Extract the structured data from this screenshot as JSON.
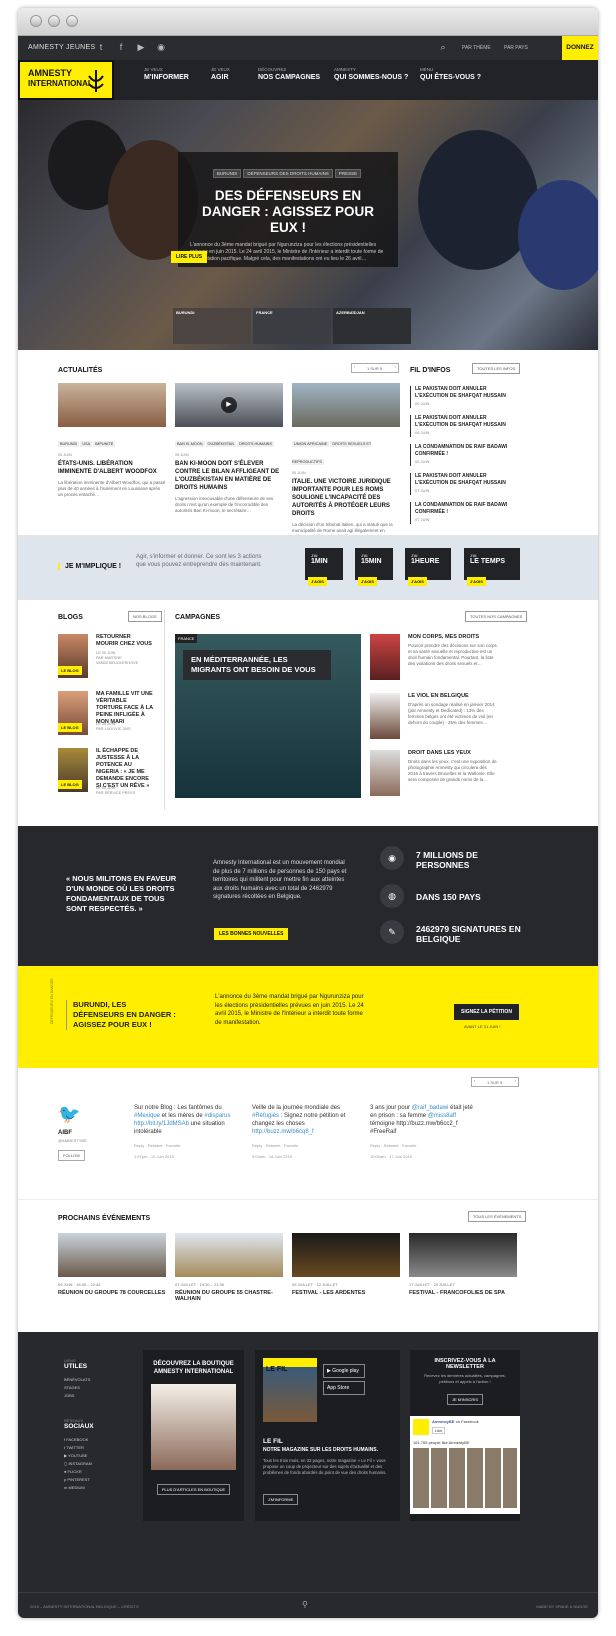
{
  "topbar": {
    "brand": "AMNESTY JEUNES",
    "theme": "PAR THÈME",
    "country": "PAR PAYS",
    "donate": "DONNEZ"
  },
  "logo": {
    "line1": "AMNESTY",
    "line2": "INTERNATIONAL"
  },
  "nav": [
    {
      "small": "JE VEUX",
      "label": "M'INFORMER"
    },
    {
      "small": "JE VEUX",
      "label": "AGIR"
    },
    {
      "small": "DÉCOUVREZ",
      "label": "NOS CAMPAGNES"
    },
    {
      "small": "AMNESTY",
      "label": "QUI SOMMES-NOUS ?"
    },
    {
      "small": "MENU",
      "label": "QUI ÊTES-VOUS ?"
    }
  ],
  "hero": {
    "tags": [
      "BURUNDI",
      "DÉFENSEURS DES DROITS HUMAINS",
      "PRESSE"
    ],
    "title": "DES DÉFENSEURS EN DANGER : AGISSEZ POUR EUX !",
    "text": "L'annonce du 3ème mandat brigué par Ngurunziza pour les élections présidentielles prévues en juin 2015. Le 24 avril 2015, le Ministre de l'Intérieur a interdit toute forme de manifestation pacifique. Malgré cela, des manifestations ont eu lieu le 26 avril…",
    "button": "LIRE PLUS",
    "thumbs": [
      "BURUNDI",
      "FRANCE",
      "AZERBAÏDJAN"
    ]
  },
  "actus": {
    "title": "ACTUALITÉS",
    "pager": "1 SUR 5",
    "cards": [
      {
        "tags": [
          "BURUNDI",
          "USA",
          "IMPUNITÉ"
        ],
        "date": "05 JUIN",
        "title": "ÉTATS-UNIS. LIBÉRATION IMMINENTE D'ALBERT WOODFOX",
        "text": "La libération imminente d'Albert Woodfox, qui a passé plus de 40 années à l'isolement en Louisiane après un procès entaché…"
      },
      {
        "tags": [
          "BAN KI-MOON",
          "OUZBÉKISTAN",
          "DROITS HUMAINS"
        ],
        "date": "05 JUIN",
        "title": "BAN KI-MOON DOIT S'ÉLEVER CONTRE LE BILAN AFFLIGEANT DE L'OUZBÉKISTAN EN MATIÈRE DE DROITS HUMAINS",
        "text": "L'agression inexcusable d'une défenseure de ses droits n'est qu'un exemple de l'incorrodible des autorités Ban Ki-moon, le secrétaire…"
      },
      {
        "tags": [
          "UNION AFRICAINE",
          "DROITS SEXUELS ET REPRODUCTIFS"
        ],
        "date": "05 JUIN",
        "title": "ITALIE. UNE VICTOIRE JURIDIQUE IMPORTANTE POUR LES ROMS SOULIGNE L'INCAPACITÉ DES AUTORITÉS À PROTÉGER LEURS DROITS",
        "text": "La décision d'un tribunal italien, qui a statué que la municipalité de Rome avait agi illégalement en reléguant de force des familles roms dans un…"
      }
    ]
  },
  "fil": {
    "title": "FIL D'INFOS",
    "button": "TOUTES LES INFOS",
    "items": [
      {
        "title": "LE PAKISTAN DOIT ANNULER L'EXÉCUTION DE SHAFQAT HUSSAIN",
        "date": "09 JUIN"
      },
      {
        "title": "LE PAKISTAN DOIT ANNULER L'EXÉCUTION DE SHAFQAT HUSSAIN",
        "date": "09 JUIN"
      },
      {
        "title": "LA CONDAMNATION DE RAIF BADAWI CONFIRMÉE !",
        "date": "09 JUIN"
      },
      {
        "title": "LE PAKISTAN DOIT ANNULER L'EXÉCUTION DE SHAFQAT HUSSAIN",
        "date": "07 JUIN"
      },
      {
        "title": "LA CONDAMNATION DE RAIF BADAWI CONFIRMÉE !",
        "date": "07 JUIN"
      }
    ]
  },
  "implique": {
    "title": "JE M'IMPLIQUE !",
    "text": "Agir, s'informer et donner. Ce sont les 3 actions que vous pouvez entreprendre dès maintenant.",
    "items": [
      {
        "s": "J'AI",
        "t": "1MIN"
      },
      {
        "s": "J'AI",
        "t": "15MIN"
      },
      {
        "s": "J'AI",
        "t": "1HEURE"
      },
      {
        "s": "J'AI",
        "t": "LE TEMPS"
      }
    ],
    "btn": "J'AGIS"
  },
  "blogs": {
    "title": "BLOGS",
    "button": "NOS BLOGS",
    "label": "LE BLOG",
    "items": [
      {
        "title": "RETOURNER MOURIR CHEZ VOUS",
        "meta1": "LE 05 JUIN",
        "meta2": "PAR MARTINE VANDENEUCKERHOVE"
      },
      {
        "title": "MA FAMILLE VIT UNE VÉRITABLE TORTURE FACE À LA PEINE INFLIGÉE À MON MARI",
        "meta1": "LE 05 JUIN",
        "meta2": "PAR LUDOVIC JAIS"
      },
      {
        "title": "IL ÉCHAPPE DE JUSTESSE À LA POTENCE AU NIGERIA : « JE ME DEMANDE ENCORE SI C'EST UN RÊVE »",
        "meta1": "LE 05 JUIN",
        "meta2": "PAR SERVICE PRESS"
      }
    ]
  },
  "campagnes": {
    "title": "CAMPAGNES",
    "button": "TOUTES NOS CAMPAGNES",
    "main_tag": "FRANCE",
    "main_title": "EN MÉDITERRANNÉE, LES MIGRANTS ONT BESOIN DE VOUS",
    "items": [
      {
        "title": "MON CORPS, MES DROITS",
        "text": "Pouvoir prendre des décisions sur son corps et sa santé sexuelle et reproductive est un droit humain fondamental. Pourtant, la liste des violations des droits sexuels et…"
      },
      {
        "title": "LE VIOL EN BELGIQUE",
        "text": "D'après un sondage réalisé en janvier 2014 (par Amnesty et Dedicated) : 13% des femmes belges ont été victimes de viol (en dehors du couple) - 25% des femmes…"
      },
      {
        "title": "DROIT DANS LES YEUX",
        "text": "Droits dans les yeux, c'est une exposition de photographie Amnesty qui circulera dès 2016 à travers Bruxelles et la Wallonie. Elle sera composée de grands noms de la…"
      }
    ]
  },
  "mission": {
    "quote": "« NOUS MILITONS EN FAVEUR D'UN MONDE OÙ LES DROITS FONDAMENTAUX DE TOUS SONT RESPECTÉS. »",
    "text": "Amnesty International est un mouvement mondial de plus de 7 millions de personnes de 150 pays et territoires qui militent pour mettre fin aux atteintes aux droits humains avec un total de 2462979 signatures récoltées en Belgique.",
    "button": "LES BONNES NOUVELLES",
    "stats": [
      "7 MILLIONS DE PERSONNES",
      "DANS 150 PAYS",
      "2462979 SIGNATURES EN BELGIQUE"
    ]
  },
  "petition": {
    "side": "DÉFENSEURS EN DANGER",
    "title": "BURUNDI, LES DÉFENSEURS EN DANGER : AGISSEZ POUR EUX !",
    "text": "L'annonce du 3ème mandat brigué par Ngurunziza pour les élections présidentielles prévues en juin 2015. Le 24 avril 2015, le Ministre de l'Intérieur a interdit toute forme de manifestation.",
    "button": "SIGNEZ LA PÉTITION",
    "deadline": "AVANT LE 31 JUIN !"
  },
  "twitter": {
    "name": "AIBF",
    "handle": "@AMNESTYBE",
    "follow": "FOLLOW",
    "pager": "1 SUR 5",
    "tweets": [
      {
        "pre": "Sur notre Blog : Les fantômes du ",
        "l1": "#Mexique",
        "mid": " et les mères de ",
        "l2": "#disparus",
        "l3": " http://bit.ly/1JdMSAb",
        "post": " une situation intolérable",
        "time": "1:57pm - 19 Juin 2015"
      },
      {
        "pre": "Veille de la journée mondiale des ",
        "l1": "#Réfugiés",
        "mid": " : Signez notre pétition et changez les choses ",
        "l2": "http://buzz.mw/",
        "l3": "b6cq8_f",
        "post": "",
        "time": "3:04am - 18 Juin 2015"
      },
      {
        "pre": "3 ans jour pour ",
        "l1": "@raif_badawi",
        "mid": " était jeté en prison : sa femme ",
        "l2": "@miss8aff",
        "l3": " témoigne http://buzz.mw/b6cc2_f #FreeRaif",
        "post": "",
        "time": "10:00am - 17 Juin 2015"
      }
    ],
    "actions": [
      "Reply",
      "Retweet",
      "Favorite"
    ]
  },
  "events": {
    "title": "PROCHAINS ÉVÉNEMENTS",
    "button": "TOUS LES ÉVÉNEMENTS",
    "items": [
      {
        "date": "09 JUIN",
        "time": "19:45 – 22:45",
        "title": "RÉUNION DU GROUPE 78 COURCELLES"
      },
      {
        "date": "07 JUILLET",
        "time": "19:30 – 21:30",
        "title": "RÉUNION DU GROUPE 55 CHASTRE-WALHAIN"
      },
      {
        "date": "09 JUILLET",
        "time": "12 JUILLET",
        "title": "FESTIVAL - LES ARDENTES"
      },
      {
        "date": "17 JUILLET",
        "time": "20 JUILLET",
        "title": "FESTIVAL - FRANCOFOLIES DE SPA"
      }
    ]
  },
  "footer": {
    "links_small": "LIENS",
    "links_title": "UTILES",
    "links": [
      "BÉNÉVOLATS",
      "STAGES",
      "JOBS"
    ],
    "social_small": "RÉSEAUX",
    "social_title": "SOCIAUX",
    "social": [
      "FACEBOOK",
      "TWITTER",
      "YOUTUBE",
      "INSTAGRAM",
      "FLICKR",
      "PINTEREST",
      "MEDIUM"
    ],
    "shop_title": "DÉCOUVREZ LA BOUTIQUE AMNESTY INTERNATIONAL",
    "shop_button": "PLUS D'ARTICLES EN BOUTIQUE",
    "lefil_logo": "LE FIL",
    "gplay": "Google play",
    "appstore": "App Store",
    "lefil_title": "LE FIL",
    "lefil_sub": "NOTRE MAGAZINE SUR LES DROITS HUMAINS.",
    "lefil_text": "Tous les trois mois, en 32 pages, notre magazine « Le Fil » vous propose un coup de projecteur sur des sujets d'actualité et des problèmes de fonds abordés du point de vue des droits humains.",
    "lefil_button": "J'M'INFORME",
    "news_title": "INSCRIVEZ-VOUS À LA NEWSLETTER",
    "news_text": "Recevez les dernières actualités, campagnes, pétitions et appels à l'action !",
    "news_button": "JE M'INSCRIS",
    "fb_name": "AmnestyBE",
    "fb_on": "on Facebook",
    "fb_like": "Like",
    "fb_count": "161,765 people like AmnestyBE",
    "copyright": "2015 – AMNESTY INTERNATIONAL BELGIQUE – CRÉDITS",
    "made": "MADE BY SPADE & NUDGE"
  },
  "colors": {
    "yellow": "#ffee00",
    "dark": "#27282c",
    "link": "#3a8ec9"
  }
}
